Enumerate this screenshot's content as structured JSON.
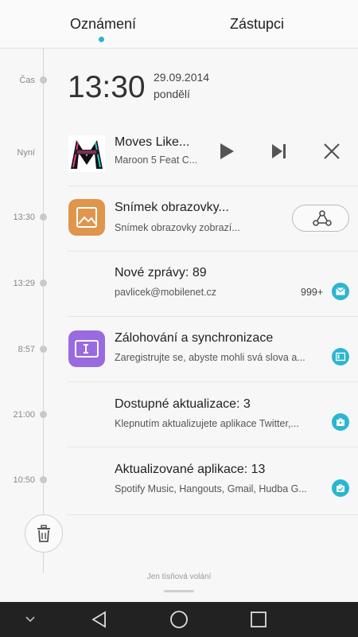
{
  "tabs": {
    "notifications": "Oznámení",
    "shortcuts": "Zástupci"
  },
  "timeline": {
    "labels": [
      "Čas",
      "Nyní",
      "13:30",
      "13:29",
      "8:57",
      "21:00",
      "10:50"
    ]
  },
  "clock": {
    "time": "13:30",
    "date": "29.09.2014",
    "day": "pondělí"
  },
  "music": {
    "title": "Moves Like...",
    "artist": "Maroon 5 Feat C..."
  },
  "notifications": [
    {
      "title": "Snímek obrazovky...",
      "sub": "Snímek obrazovky zobrazí..."
    },
    {
      "title": "Nové zprávy: 89",
      "sub": "pavlicek@mobilenet.cz",
      "count": "999+"
    },
    {
      "title": "Zálohování a synchronizace",
      "sub": "Zaregistrujte se, abyste mohli svá slova a..."
    },
    {
      "title": "Dostupné aktualizace: 3",
      "sub": "Klepnutím aktualizujete aplikace Twitter,..."
    },
    {
      "title": "Aktualizované aplikace: 13",
      "sub": "Spotify Music, Hangouts, Gmail, Hudba G..."
    }
  ],
  "footer": {
    "emergency": "Jen tísňová volání"
  },
  "colors": {
    "accent": "#2bb6d0",
    "screenshot_icon": "#e0954c",
    "backup_icon": "#9a6ae0"
  },
  "icons": [
    "play-icon",
    "next-icon",
    "close-icon",
    "share-icon",
    "image-icon",
    "mail-icon",
    "backup-icon",
    "store-icon",
    "trash-icon",
    "back-icon",
    "home-icon",
    "recents-icon",
    "chevron-down-icon"
  ]
}
